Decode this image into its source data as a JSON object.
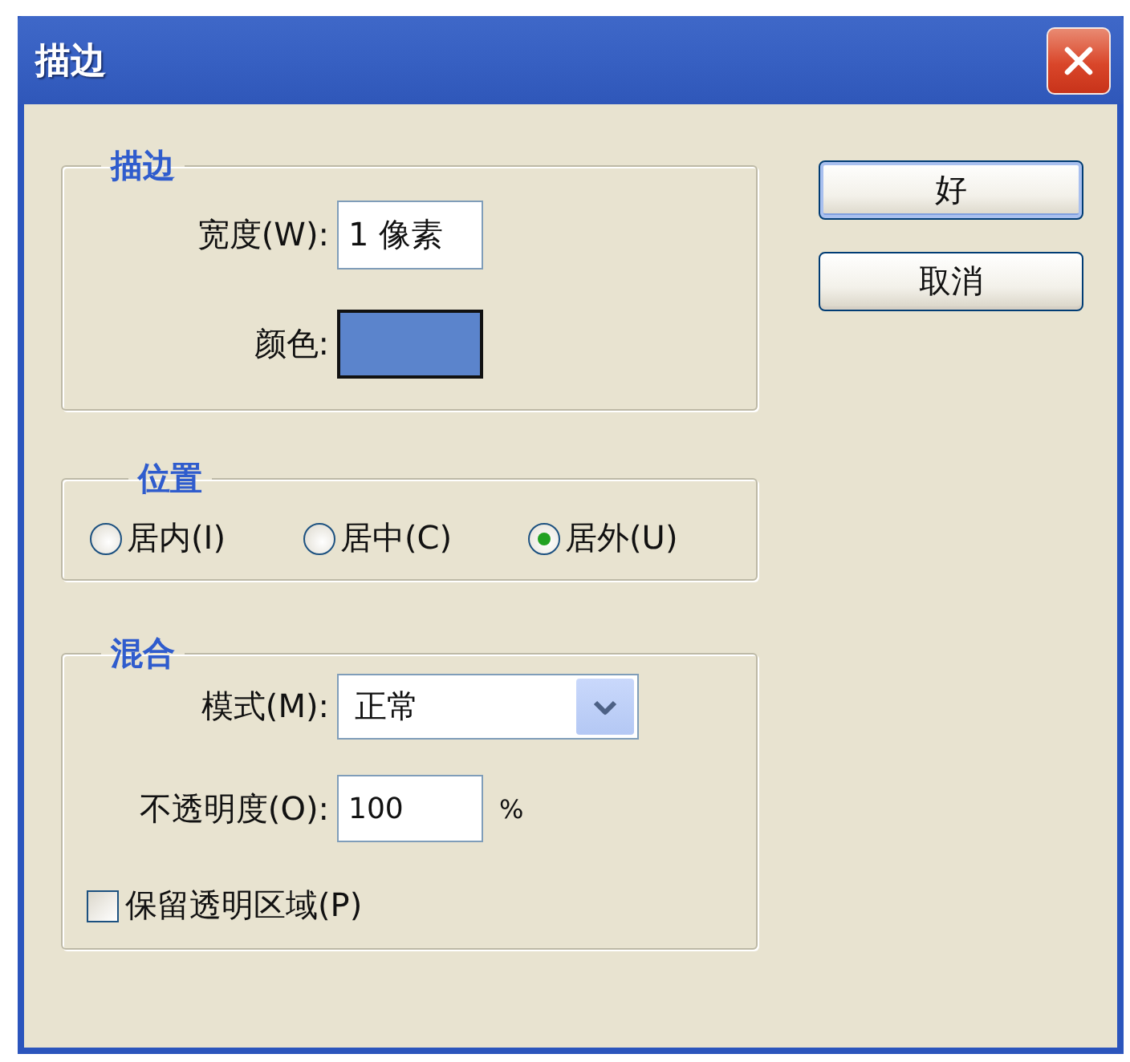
{
  "window": {
    "title": "描边"
  },
  "stroke_group": {
    "legend": "描边",
    "width": {
      "label": "宽度(W):",
      "value": "1 像素"
    },
    "color": {
      "label": "颜色:",
      "color": "#5b84cc"
    }
  },
  "position_group": {
    "legend": "位置",
    "options": [
      {
        "label": "居内(I)",
        "selected": false
      },
      {
        "label": "居中(C)",
        "selected": false
      },
      {
        "label": "居外(U)",
        "selected": true
      }
    ]
  },
  "blend_group": {
    "legend": "混合",
    "mode": {
      "label": "模式(M):",
      "value": "正常"
    },
    "opacity": {
      "label": "不透明度(O):",
      "value": "100",
      "unit": "%"
    },
    "preserve_transparency": {
      "label": "保留透明区域(P)",
      "checked": false
    }
  },
  "buttons": [
    {
      "label": "好",
      "default": true
    },
    {
      "label": "取消",
      "default": false
    }
  ]
}
